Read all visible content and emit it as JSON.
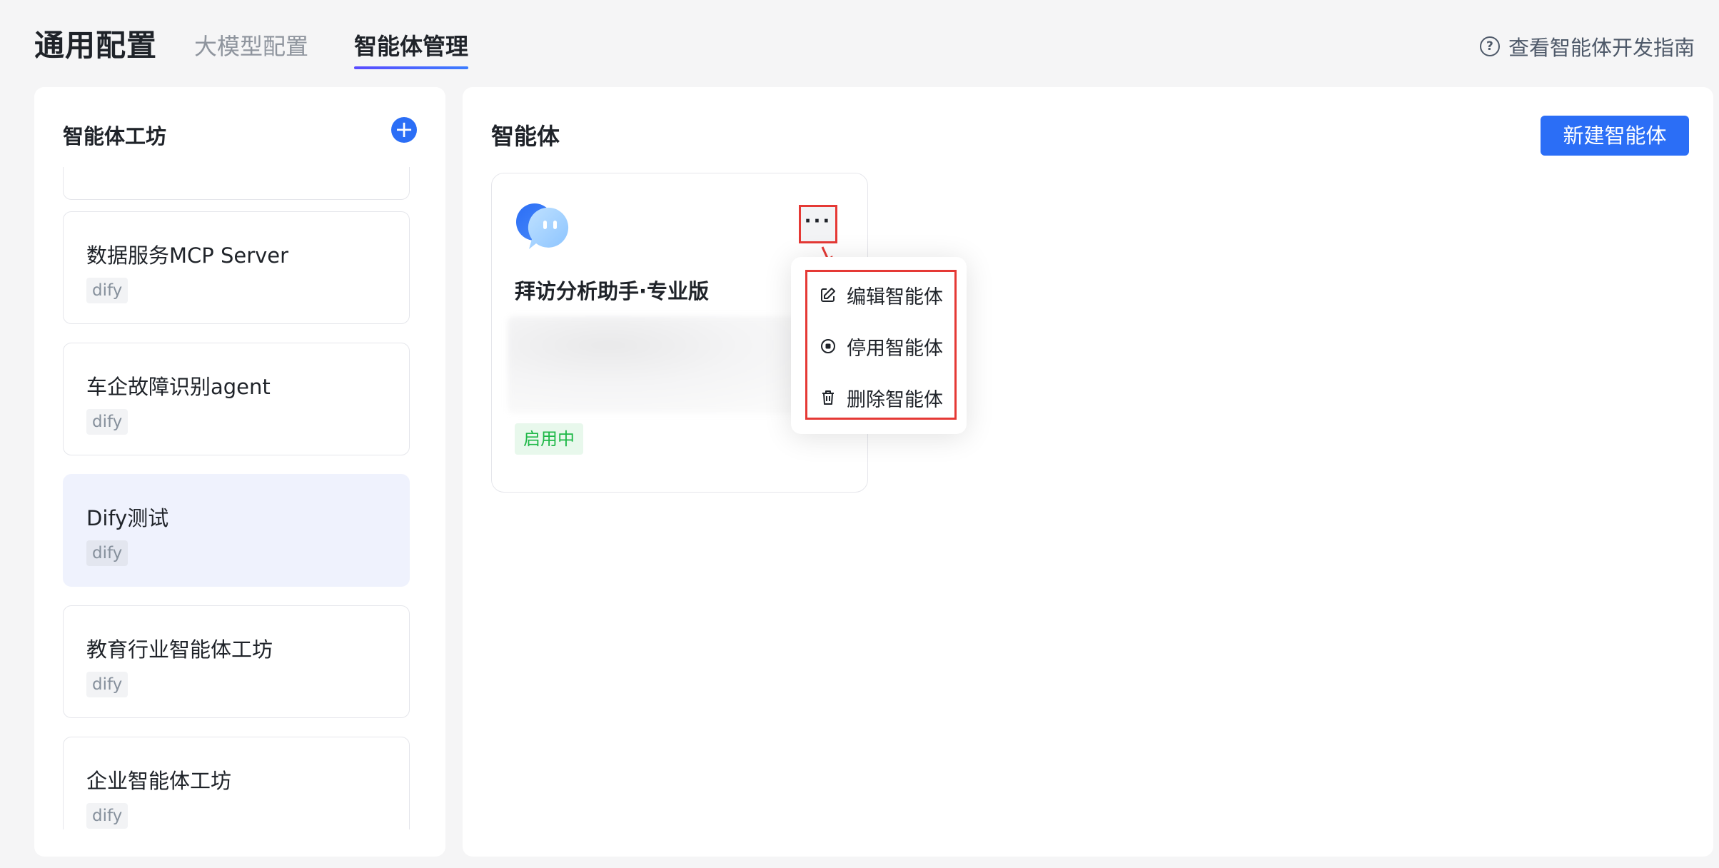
{
  "header": {
    "brand": "通用配置",
    "tabs": [
      {
        "label": "大模型配置"
      },
      {
        "label": "智能体管理"
      }
    ],
    "guide_label": "查看智能体开发指南",
    "guide_icon": "question-circle-icon"
  },
  "workshop_panel": {
    "title": "智能体工坊",
    "add_icon": "plus-icon",
    "items": [
      {
        "name": "数据服务MCP Server",
        "tag": "dify"
      },
      {
        "name": "车企故障识别agent",
        "tag": "dify"
      },
      {
        "name": "Dify测试",
        "tag": "dify",
        "active": true
      },
      {
        "name": "教育行业智能体工坊",
        "tag": "dify"
      },
      {
        "name": "企业智能体工坊",
        "tag": "dify"
      }
    ]
  },
  "agent_panel": {
    "title": "智能体",
    "new_button": "新建智能体",
    "agents": [
      {
        "name": "拜访分析助手·专业版",
        "status": "启用中",
        "status_color": "#1fb848",
        "more_icon": "more-horizontal-icon"
      }
    ]
  },
  "context_menu": {
    "items": [
      {
        "label": "编辑智能体",
        "icon": "edit-icon"
      },
      {
        "label": "停用智能体",
        "icon": "stop-circle-icon"
      },
      {
        "label": "删除智能体",
        "icon": "trash-icon"
      }
    ]
  },
  "colors": {
    "primary": "#2b6ef6",
    "highlight": "#e53935",
    "active_bg": "#eff2fd"
  }
}
